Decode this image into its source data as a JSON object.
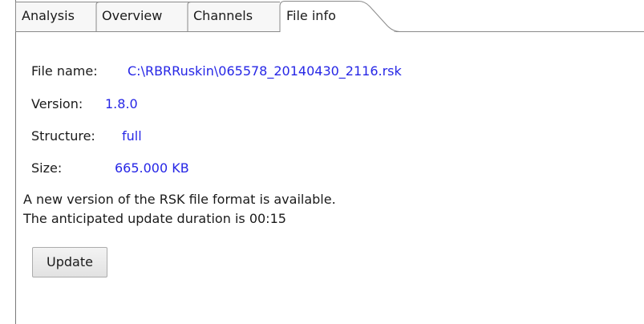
{
  "tabs": [
    {
      "label": "Analysis",
      "active": false
    },
    {
      "label": "Overview",
      "active": false
    },
    {
      "label": "Channels",
      "active": false
    },
    {
      "label": "File info",
      "active": true
    }
  ],
  "file_info": {
    "file_name_label": "File name:",
    "file_name_value": "C:\\RBRRuskin\\065578_20140430_2116.rsk",
    "version_label": "Version:",
    "version_value": "1.8.0",
    "structure_label": "Structure:",
    "structure_value": "full",
    "size_label": "Size:",
    "size_value": "665.000 KB"
  },
  "notice": {
    "line1": "A new version of the RSK file format is available.",
    "line2": "The anticipated update duration is 00:15"
  },
  "update_button_label": "Update",
  "colors": {
    "value_text": "#2626e6",
    "label_text": "#1a1a1a",
    "tab_border": "#8a8a8a"
  }
}
